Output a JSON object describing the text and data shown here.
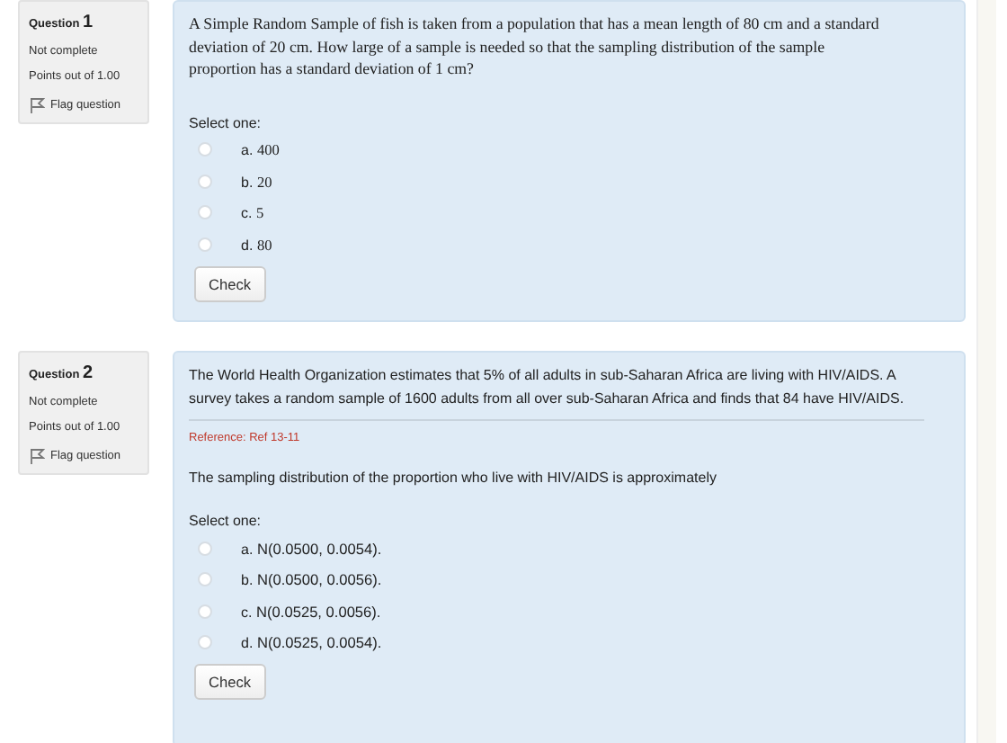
{
  "questions": [
    {
      "label": "Question",
      "number": "1",
      "status": "Not complete",
      "points": "Points out of 1.00",
      "flag": "Flag question",
      "kind": "serif",
      "text": "A Simple Random Sample of fish is taken from a population that has a mean length of 80 cm and a standard deviation of 20 cm. How large of a sample is needed so that the sampling distribution of the sample proportion has a standard deviation of 1 cm?",
      "prompt": "Select one:",
      "options": [
        {
          "letter": "a.",
          "text": "400",
          "selected": false
        },
        {
          "letter": "b.",
          "text": "20",
          "selected": false
        },
        {
          "letter": "c.",
          "text": "5",
          "selected": false
        },
        {
          "letter": "d.",
          "text": "80",
          "selected": false
        }
      ],
      "button": "Check"
    },
    {
      "label": "Question",
      "number": "2",
      "status": "Not complete",
      "points": "Points out of 1.00",
      "flag": "Flag question",
      "kind": "sans",
      "text": "The World Health Organization estimates that 5% of all adults in sub-Saharan Africa are living with HIV/AIDS. A survey takes a random sample of 1600 adults from all over sub-Saharan Africa and finds that 84 have HIV/AIDS.",
      "reference": "Reference: Ref 13-11",
      "stem": "The sampling distribution of the proportion who live with HIV/AIDS is approximately",
      "prompt": "Select one:",
      "options": [
        {
          "letter": "a.",
          "text": "N(0.0500, 0.0054).",
          "selected": false
        },
        {
          "letter": "b.",
          "text": "N(0.0500, 0.0056).",
          "selected": false
        },
        {
          "letter": "c.",
          "text": "N(0.0525, 0.0056).",
          "selected": false
        },
        {
          "letter": "d.",
          "text": "N(0.0525, 0.0054).",
          "selected": false
        }
      ],
      "button": "Check"
    }
  ]
}
